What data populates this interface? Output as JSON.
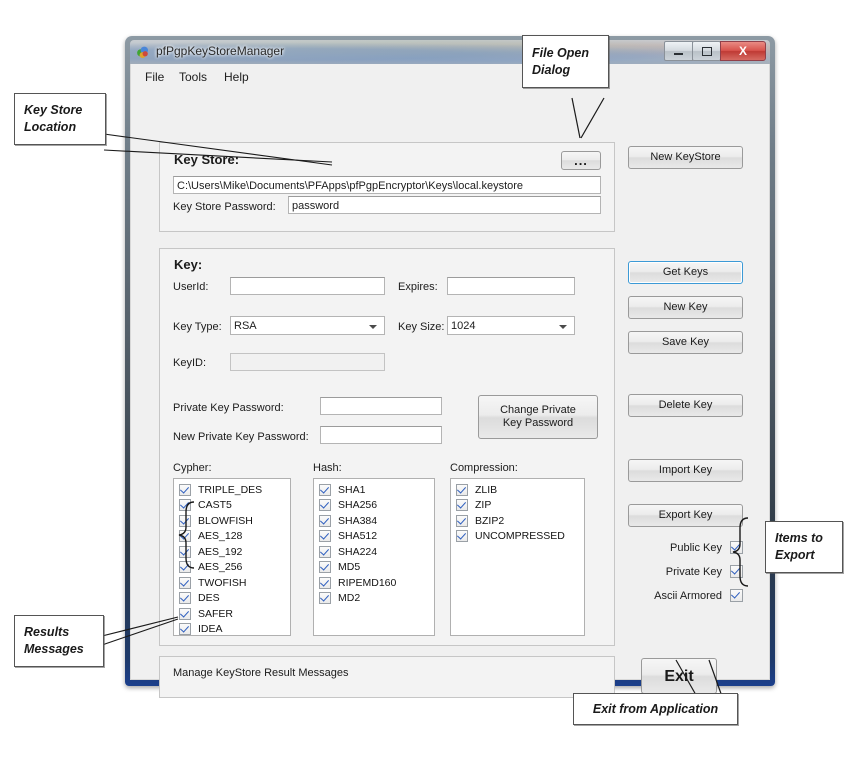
{
  "window": {
    "title": "pfPgpKeyStoreManager",
    "icon": "app-logo-icon",
    "buttons": {
      "minimize": "minimize-icon",
      "maximize": "maximize-icon",
      "close": "X"
    }
  },
  "menubar": {
    "items": [
      "File",
      "Tools",
      "Help"
    ]
  },
  "keystore": {
    "group_title": "Key Store:",
    "browse_button": "...",
    "path_value": "C:\\Users\\Mike\\Documents\\PFApps\\pfPgpEncryptor\\Keys\\local.keystore",
    "password_label": "Key Store Password:",
    "password_value": "password"
  },
  "key": {
    "group_title": "Key:",
    "userid_label": "UserId:",
    "userid_value": "",
    "expires_label": "Expires:",
    "expires_value": "",
    "keytype_label": "Key Type:",
    "keytype_value": "RSA",
    "keysize_label": "Key Size:",
    "keysize_value": "1024",
    "keyid_label": "KeyID:",
    "keyid_value": "",
    "private_pw_label": "Private Key Password:",
    "private_pw_value": "",
    "new_private_pw_label": "New Private Key Password:",
    "new_private_pw_value": "",
    "change_pw_button": "Change Private\nKey Password",
    "change_pw_button_line1": "Change Private",
    "change_pw_button_line2": "Key Password"
  },
  "lists": {
    "cypher": {
      "label": "Cypher:",
      "items": [
        {
          "label": "TRIPLE_DES",
          "checked": true
        },
        {
          "label": "CAST5",
          "checked": true
        },
        {
          "label": "BLOWFISH",
          "checked": true
        },
        {
          "label": "AES_128",
          "checked": true
        },
        {
          "label": "AES_192",
          "checked": true
        },
        {
          "label": "AES_256",
          "checked": true
        },
        {
          "label": "TWOFISH",
          "checked": true
        },
        {
          "label": "DES",
          "checked": true
        },
        {
          "label": "SAFER",
          "checked": true
        },
        {
          "label": "IDEA",
          "checked": true
        }
      ]
    },
    "hash": {
      "label": "Hash:",
      "items": [
        {
          "label": "SHA1",
          "checked": true
        },
        {
          "label": "SHA256",
          "checked": true
        },
        {
          "label": "SHA384",
          "checked": true
        },
        {
          "label": "SHA512",
          "checked": true
        },
        {
          "label": "SHA224",
          "checked": true
        },
        {
          "label": "MD5",
          "checked": true
        },
        {
          "label": "RIPEMD160",
          "checked": true
        },
        {
          "label": "MD2",
          "checked": true
        }
      ]
    },
    "compression": {
      "label": "Compression:",
      "items": [
        {
          "label": "ZLIB",
          "checked": true
        },
        {
          "label": "ZIP",
          "checked": true
        },
        {
          "label": "BZIP2",
          "checked": true
        },
        {
          "label": "UNCOMPRESSED",
          "checked": true
        }
      ]
    }
  },
  "status": {
    "message": "Manage KeyStore Result Messages"
  },
  "sidebuttons": {
    "new_keystore": "New KeyStore",
    "get_keys": "Get Keys",
    "new_key": "New Key",
    "save_key": "Save Key",
    "delete_key": "Delete Key",
    "import_key": "Import Key",
    "export_key": "Export Key",
    "exit": "Exit"
  },
  "export_options": [
    {
      "label": "Public Key",
      "checked": true
    },
    {
      "label": "Private Key",
      "checked": true
    },
    {
      "label": "Ascii Armored",
      "checked": true
    }
  ],
  "annotations": {
    "keystore_location": {
      "line1": "Key Store",
      "line2": "Location"
    },
    "file_open_dialog": {
      "line1": "File Open",
      "line2": "Dialog"
    },
    "items_to_export": {
      "line1": "Items to",
      "line2": "Export"
    },
    "results_messages": {
      "line1": "Results",
      "line2": "Messages"
    },
    "exit_from_application": {
      "line1": "Exit from Application"
    }
  },
  "colors": {
    "accent_focus": "#3c9ad6",
    "close_button": "#d8534c",
    "check_mark": "#2f5fbf",
    "window_border": "#1b3f8c"
  }
}
